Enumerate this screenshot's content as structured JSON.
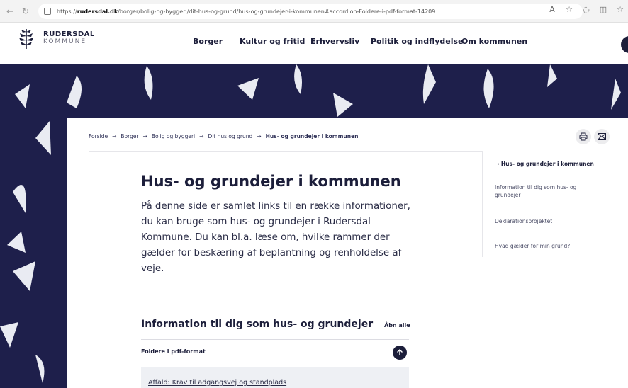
{
  "browser": {
    "url_prefix": "https://",
    "url_host": "rudersdal.dk",
    "url_path": "/borger/bolig-og-byggeri/dit-hus-og-grund/hus-og-grundejer-i-kommunen#accordion-Foldere-i-pdf-format-14209"
  },
  "logo": {
    "line1": "RUDERSDAL",
    "line2": "KOMMUNE"
  },
  "nav": {
    "items": [
      "Borger",
      "Kultur og fritid",
      "Erhvervsliv",
      "Politik og indflydelse",
      "Om kommunen"
    ]
  },
  "breadcrumb": {
    "items": [
      "Forside",
      "Borger",
      "Bolig og byggeri",
      "Dit hus og grund"
    ],
    "separator": "→",
    "current": "Hus- og grundejer i kommunen"
  },
  "page": {
    "title": "Hus- og grundejer i kommunen",
    "intro": "På denne side er samlet links til en række informationer, du kan bruge som hus- og grundejer i Rudersdal Kommune. Du kan bl.a. læse om, hvilke rammer der gælder for beskæring af beplantning og renholdelse af veje."
  },
  "toc": {
    "active": "→  Hus- og grundejer i kommunen",
    "items": [
      "Information til dig som hus- og grundejer",
      "Deklarationsprojektet",
      "Hvad gælder for min grund?"
    ]
  },
  "accordion": {
    "title": "Information til dig som hus- og grundejer",
    "open_all": "Åbn alle",
    "section_label": "Foldere i pdf-format",
    "first_link": "Affald: Krav til adgangsvej og standplads"
  },
  "colors": {
    "navy": "#1e1f4b",
    "text": "#1c1e3a",
    "leaf": "#e9ebf2"
  }
}
